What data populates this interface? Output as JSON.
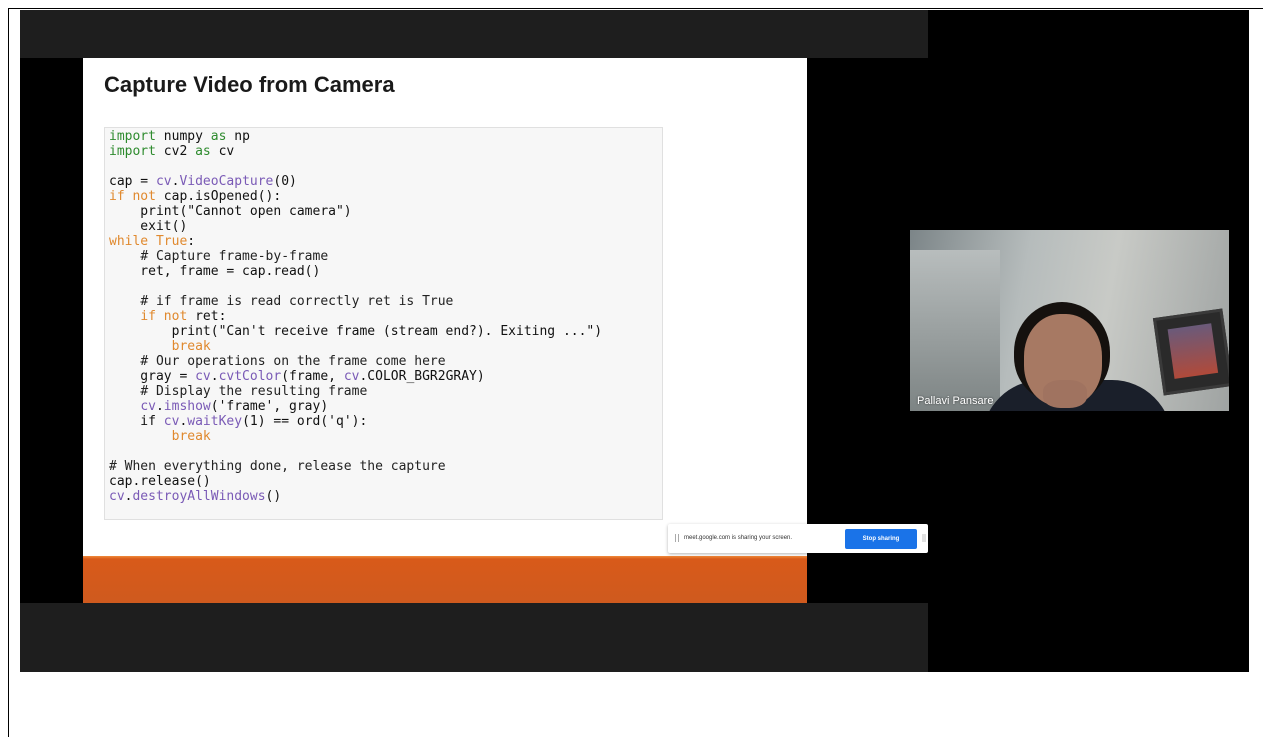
{
  "slide": {
    "title": "Capture Video from Camera",
    "code_lines": [
      "import numpy as np",
      "import cv2 as cv",
      "",
      "cap = cv.VideoCapture(0)",
      "if not cap.isOpened():",
      "    print(\"Cannot open camera\")",
      "    exit()",
      "while True:",
      "    # Capture frame-by-frame",
      "    ret, frame = cap.read()",
      "",
      "    # if frame is read correctly ret is True",
      "    if not ret:",
      "        print(\"Can't receive frame (stream end?). Exiting ...\")",
      "        break",
      "    # Our operations on the frame come here",
      "    gray = cv.cvtColor(frame, cv.COLOR_BGR2GRAY)",
      "    # Display the resulting frame",
      "    cv.imshow('frame', gray)",
      "    if cv.waitKey(1) == ord('q'):",
      "        break",
      "",
      "# When everything done, release the capture",
      "cap.release()",
      "cv.destroyAllWindows()"
    ]
  },
  "share_bar": {
    "message": "meet.google.com is sharing your screen.",
    "stop_label": "Stop sharing"
  },
  "participant": {
    "name": "Pallavi Pansare"
  },
  "colors": {
    "accent_orange": "#d85a1a",
    "meet_blue": "#1a73e8",
    "keyword_green": "#2e8b2e",
    "control_orange": "#e0892e",
    "function_purple": "#7a5ab6"
  }
}
